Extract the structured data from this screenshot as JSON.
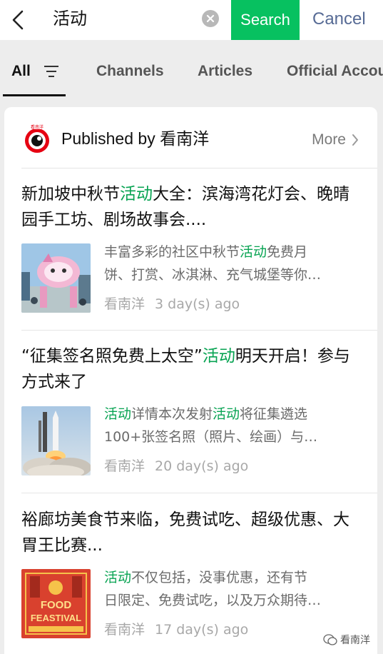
{
  "header": {
    "query": "活动",
    "search_label": "Search",
    "cancel_label": "Cancel"
  },
  "tabs": [
    {
      "label": "All",
      "active": true
    },
    {
      "label": "Channels"
    },
    {
      "label": "Articles"
    },
    {
      "label": "Official Accounts"
    }
  ],
  "publisher": {
    "label": "Published by 看南洋",
    "more_label": "More"
  },
  "articles": [
    {
      "title_pre": "新加坡中秋节",
      "title_hl": "活动",
      "title_post": "大全：滨海湾花灯会、晚晴园手工坊、剧场故事会....",
      "snippet_line1_pre": "丰富多彩的社区中秋节",
      "snippet_line1_hl": "活动",
      "snippet_line1_post": "免费月",
      "snippet_line2": "饼、打赏、冰淇淋、充气城堡等你…",
      "source": "看南洋",
      "time": "3 day(s) ago",
      "thumb": "lantern-festival-photo"
    },
    {
      "title_pre": "“征集签名照免费上太空”",
      "title_hl": "活动",
      "title_post": "明天开启！参与方式来了",
      "snippet_line1_hl_a": "活动",
      "snippet_line1_mid": "详情本次发射",
      "snippet_line1_hl_b": "活动",
      "snippet_line1_post": "将征集遴选",
      "snippet_line2": "100+张签名照（照片、绘画）与…",
      "source": "看南洋",
      "time": "20 day(s) ago",
      "thumb": "rocket-launch-photo"
    },
    {
      "title_pre": "裕廊坊美食节来临，免费试吃、超级优惠、大胃王比赛...",
      "snippet_line1_hl": "活动",
      "snippet_line1_post": "不仅包括，没事优惠，还有节",
      "snippet_line2": "日限定、免费试吃，以及万众期待…",
      "source": "看南洋",
      "time": "17 day(s) ago",
      "thumb": "food-festival-poster",
      "thumb_text": "FOOD FEASTIVAL"
    }
  ],
  "watermark": "看南洋",
  "colors": {
    "accent_green": "#07c160",
    "highlight_green": "#07a352",
    "link_blue": "#576b95"
  },
  "icons": [
    "back-arrow-icon",
    "clear-icon",
    "filter-icon",
    "chevron-right-icon",
    "wechat-icon"
  ]
}
